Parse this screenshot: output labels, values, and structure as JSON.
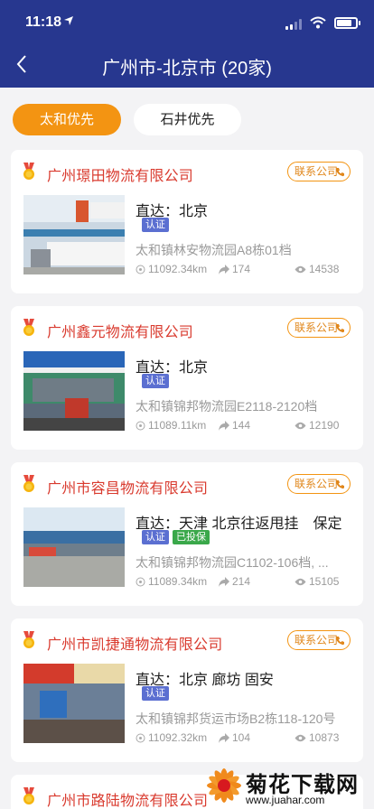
{
  "status_bar": {
    "time": "11:18"
  },
  "header": {
    "title": "广州市-北京市 (20家)"
  },
  "tabs": [
    {
      "label": "太和优先",
      "active": true
    },
    {
      "label": "石井优先",
      "active": false
    }
  ],
  "contact_label": "联系公司",
  "listings": [
    {
      "company": "广州璟田物流有限公司",
      "route": "直达：北京",
      "badges": [
        "认证"
      ],
      "address": "太和镇林安物流园A8栋01档",
      "distance": "11092.34km",
      "shares": "174",
      "views": "14538"
    },
    {
      "company": "广州鑫元物流有限公司",
      "route": "直达：北京",
      "badges": [
        "认证"
      ],
      "address": "太和镇锦邦物流园E2118-2120档",
      "distance": "11089.11km",
      "shares": "144",
      "views": "12190"
    },
    {
      "company": "广州市容昌物流有限公司",
      "route": "直达：天津 北京往返甩挂　保定",
      "badges": [
        "认证",
        "已投保"
      ],
      "address": "太和镇锦邦物流园C1102-106档, ...",
      "distance": "11089.34km",
      "shares": "214",
      "views": "15105"
    },
    {
      "company": "广州市凯捷通物流有限公司",
      "route": "直达：北京 廊坊 固安",
      "badges": [
        "认证"
      ],
      "address": "太和镇锦邦货运市场B2栋118-120号",
      "distance": "11092.32km",
      "shares": "104",
      "views": "10873"
    },
    {
      "company": "广州市路陆物流有限公司"
    }
  ],
  "watermark": {
    "title": "菊花下载网",
    "url": "www.juahar.com"
  },
  "colors": {
    "header": "#27378f",
    "accent": "#f39412",
    "company_red": "#d93a2e"
  },
  "icons": [
    "location-arrow-icon",
    "signal-icon",
    "wifi-icon",
    "battery-icon",
    "back-arrow-icon",
    "medal-icon",
    "phone-icon",
    "crosshair-icon",
    "share-arrow-icon",
    "eye-icon"
  ]
}
